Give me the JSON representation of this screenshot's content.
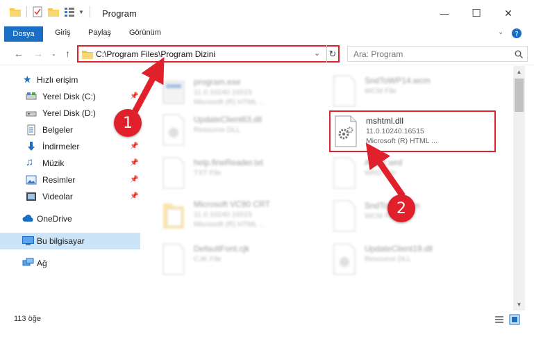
{
  "window": {
    "title": "Program",
    "minimize_glyph": "—",
    "maximize_glyph": "☐",
    "close_glyph": "✕"
  },
  "ribbon": {
    "tabs": [
      "Dosya",
      "Giriş",
      "Paylaş",
      "Görünüm"
    ]
  },
  "address": {
    "path": "C:\\Program Files\\Program Dizini",
    "search_placeholder": "Ara: Program"
  },
  "nav": {
    "quick_access": "Hızlı erişim",
    "items": [
      {
        "label": "Yerel Disk (C:)",
        "icon": "drive-icon",
        "pinned": true
      },
      {
        "label": "Yerel Disk (D:)",
        "icon": "drive-icon",
        "pinned": true
      },
      {
        "label": "Belgeler",
        "icon": "documents-icon",
        "pinned": true
      },
      {
        "label": "İndirmeler",
        "icon": "downloads-icon",
        "pinned": true
      },
      {
        "label": "Müzik",
        "icon": "music-icon",
        "pinned": true
      },
      {
        "label": "Resimler",
        "icon": "pictures-icon",
        "pinned": true
      },
      {
        "label": "Videolar",
        "icon": "videos-icon",
        "pinned": true
      }
    ],
    "onedrive": "OneDrive",
    "this_pc": "Bu bilgisayar",
    "network": "Ağ"
  },
  "files": {
    "col1": [
      {
        "name": "program.exe",
        "line2": "11.0.10240.16515",
        "line3": "Microsoft (R) HTML ..."
      },
      {
        "name": "UpdateClient63.dll",
        "line2": "Resource DLL",
        "line3": ""
      },
      {
        "name": "help.fineReader.txt",
        "line2": "TXT File",
        "line3": ""
      },
      {
        "name": "Microsoft VC90 CRT",
        "line2": "11.0.10240.16515",
        "line3": "Microsoft (R) HTML ..."
      },
      {
        "name": "DefaultFont.cjk",
        "line2": "CJK File",
        "line3": ""
      }
    ],
    "col2": [
      {
        "name": "SndToWP14.wcm",
        "line2": "WCM File",
        "line3": ""
      },
      {
        "name": "mshtml.dll",
        "line2": "11.0.10240.16515",
        "line3": "Microsoft (R) HTML ..."
      },
      {
        "name": "Afrtec.wrd",
        "line2": "WRD File",
        "line3": ""
      },
      {
        "name": "SndToWP.wcm",
        "line2": "WCM File",
        "line3": ""
      },
      {
        "name": "UpdateClient19.dll",
        "line2": "Resource DLL",
        "line3": ""
      }
    ]
  },
  "status": {
    "count": "113 öğe"
  },
  "annotations": [
    "1",
    "2"
  ],
  "colors": {
    "accent": "#1a6fc4",
    "highlight": "#e0202a",
    "selected_nav": "#cce4f7"
  }
}
